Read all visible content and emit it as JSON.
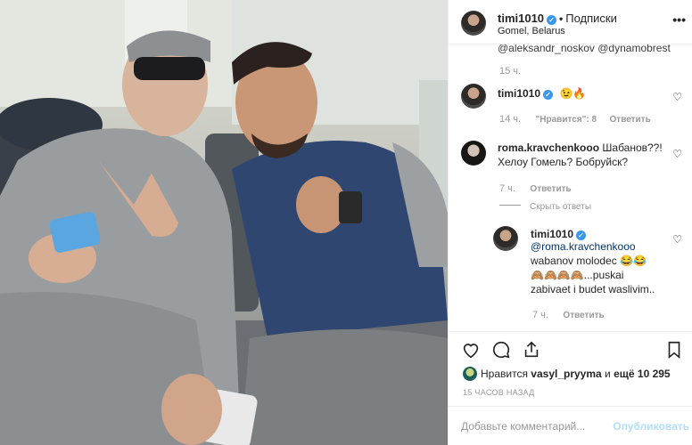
{
  "header": {
    "username": "timi1010",
    "dot": "•",
    "follow_label": "Подписки",
    "location": "Gomel, Belarus",
    "more_icon": "more-horizontal-icon",
    "verified_mark": "✓"
  },
  "comments": {
    "cut_text": "@aleksandr_noskov @dynamobrest",
    "first_time": "15 ч.",
    "c1": {
      "user": "timi1010",
      "text": "😉🔥",
      "time": "14 ч.",
      "likes": "\"Нравится\": 8",
      "reply": "Ответить"
    },
    "c2": {
      "user": "roma.kravchenkooo",
      "text": "Шабанов??! Хелоу Гомель? Бобруйск?",
      "time": "7 ч.",
      "reply": "Ответить",
      "hide_replies": "Скрыть ответы"
    },
    "c3": {
      "user": "timi1010",
      "mention": "@roma.kravchenkooo",
      "text1": "wabanov molodec 😂😂",
      "text2": "🙈🙈🙈🙈...puskai zabivaet i budet waslivim..",
      "time": "7 ч.",
      "reply": "Ответить"
    }
  },
  "actions": {
    "like_icon": "heart-icon",
    "comment_icon": "comment-icon",
    "share_icon": "share-icon",
    "save_icon": "bookmark-icon"
  },
  "likes": {
    "prefix": "Нравится",
    "user": "vasyl_pryyma",
    "suffix_and": "и",
    "suffix_more": "ещё 10 295"
  },
  "posted": "15 ЧАСОВ НАЗАД",
  "add_comment": {
    "placeholder": "Добавьте комментарий...",
    "publish_label": "Опубликовать"
  },
  "colors": {
    "accent": "#3897f0",
    "publish_disabled": "#b2dffc",
    "muted": "#999999"
  }
}
